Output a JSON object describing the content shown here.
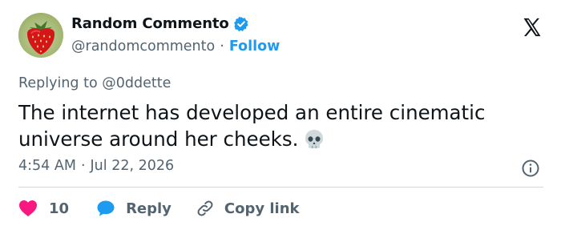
{
  "author": {
    "display_name": "Random Commento",
    "handle": "@randomcommento",
    "separator": "·",
    "follow_label": "Follow",
    "verified": true
  },
  "tweet": {
    "replying_prefix": "Replying to ",
    "replying_to": "@0ddette",
    "text": "The internet has developed an entire cinematic universe around her cheeks.",
    "emoji": "skull",
    "time": "4:54 AM",
    "date_separator": "·",
    "date": "Jul 22, 2026"
  },
  "actions": {
    "like_count": "10",
    "reply_label": "Reply",
    "copy_link_label": "Copy link"
  },
  "colors": {
    "accent": "#1d9bf0",
    "like": "#f91880",
    "text_secondary": "#536471",
    "divider": "#cfd9de"
  },
  "icons": [
    "avatar-strawberry",
    "verified-badge-icon",
    "x-logo-icon",
    "skull-emoji",
    "info-icon",
    "heart-icon",
    "reply-bubble-icon",
    "link-icon"
  ]
}
